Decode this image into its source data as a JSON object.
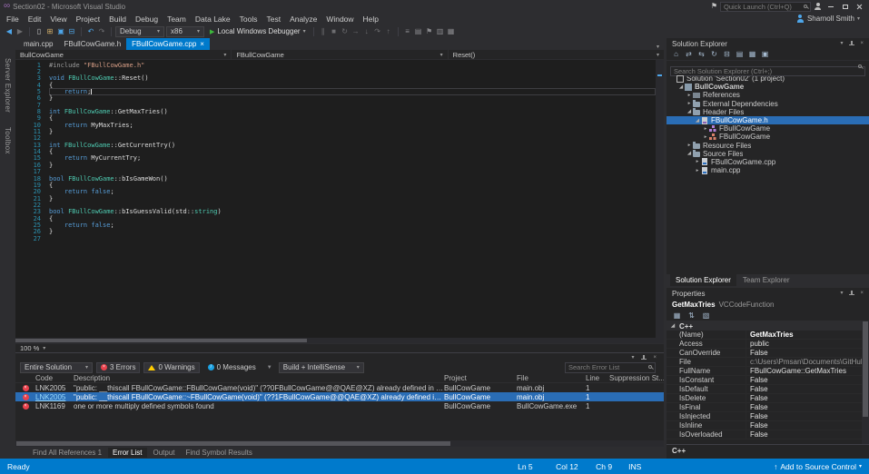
{
  "glyphs": {
    "caret": "▾",
    "chevron_down": "▾",
    "close": "×",
    "play": "▶",
    "flag": "⚑",
    "infinity": "∞",
    "up_arrow": "↑",
    "expand_down": "◢",
    "expand_right": "▸",
    "info_letter": "i",
    "filter": "▼"
  },
  "titlebar": {
    "title": "Section02 - Microsoft Visual Studio",
    "quick_launch_placeholder": "Quick Launch (Ctrl+Q)"
  },
  "menubar": {
    "items": [
      "File",
      "Edit",
      "View",
      "Project",
      "Build",
      "Debug",
      "Team",
      "Data Lake",
      "Tools",
      "Test",
      "Analyze",
      "Window",
      "Help"
    ],
    "account_name": "Sharnoll Smith"
  },
  "toolbar": {
    "icons_nav": [
      {
        "name": "navigate-back",
        "glyph": "◀",
        "color": "#4ea6ea"
      },
      {
        "name": "navigate-forward",
        "glyph": "▶",
        "color": "#6d6d70"
      }
    ],
    "icons_file": [
      {
        "name": "new-file",
        "glyph": "▯",
        "color": "#c8c8c8"
      },
      {
        "name": "open-file",
        "glyph": "⊞",
        "color": "#d8b36c"
      },
      {
        "name": "save",
        "glyph": "▣",
        "color": "#4ea6ea"
      },
      {
        "name": "save-all",
        "glyph": "⊟",
        "color": "#4ea6ea"
      }
    ],
    "icons_edit": [
      {
        "name": "undo",
        "glyph": "↶",
        "color": "#4ea6ea"
      },
      {
        "name": "redo",
        "glyph": "↷",
        "color": "#6d6d70"
      }
    ],
    "config": "Debug",
    "platform": "x86",
    "run_label": "Local Windows Debugger",
    "icons_debug": [
      {
        "name": "break-all",
        "glyph": "∥",
        "color": "#6d6d70"
      },
      {
        "name": "stop",
        "glyph": "■",
        "color": "#6d6d70"
      },
      {
        "name": "restart",
        "glyph": "↻",
        "color": "#6d6d70"
      },
      {
        "name": "show-next-statement",
        "glyph": "→",
        "color": "#6d6d70"
      },
      {
        "name": "step-into",
        "glyph": "↓",
        "color": "#6d6d70"
      },
      {
        "name": "step-over",
        "glyph": "↷",
        "color": "#6d6d70"
      },
      {
        "name": "step-out",
        "glyph": "↑",
        "color": "#6d6d70"
      }
    ],
    "icons_misc": [
      {
        "name": "solution-configurations",
        "glyph": "≡",
        "color": "#8a8a8e"
      },
      {
        "name": "find-in-files",
        "glyph": "▤",
        "color": "#8a8a8e"
      },
      {
        "name": "bookmark",
        "glyph": "⚑",
        "color": "#8a8a8e"
      },
      {
        "name": "comment",
        "glyph": "▥",
        "color": "#8a8a8e"
      },
      {
        "name": "uncomment",
        "glyph": "▦",
        "color": "#8a8a8e"
      }
    ]
  },
  "left_strip": {
    "tabs": [
      "Server Explorer",
      "Toolbox"
    ]
  },
  "editor": {
    "tabs": [
      {
        "label": "main.cpp",
        "active": false
      },
      {
        "label": "FBullCowGame.h",
        "active": false
      },
      {
        "label": "FBullCowGame.cpp",
        "active": true
      }
    ],
    "navbar": {
      "project": "BullCowGame",
      "type": "FBullCowGame",
      "member": "Reset()"
    },
    "zoom": "100 %",
    "lines": [
      {
        "n": 1,
        "s": [
          [
            "pp",
            "#include "
          ],
          [
            "str",
            "\"FBullCowGame.h\""
          ]
        ]
      },
      {
        "n": 2,
        "s": []
      },
      {
        "n": 3,
        "s": [
          [
            "kw",
            "void "
          ],
          [
            "ty",
            "FBullCowGame"
          ],
          [
            "pl",
            "::Reset()"
          ]
        ]
      },
      {
        "n": 4,
        "s": [
          [
            "pl",
            "{"
          ]
        ]
      },
      {
        "n": 5,
        "cur": true,
        "caret": true,
        "s": [
          [
            "pl",
            "    "
          ],
          [
            "kw",
            "return"
          ],
          [
            "pl",
            ";"
          ]
        ]
      },
      {
        "n": 6,
        "s": [
          [
            "pl",
            "}"
          ]
        ]
      },
      {
        "n": 7,
        "s": []
      },
      {
        "n": 8,
        "s": [
          [
            "kw",
            "int "
          ],
          [
            "ty",
            "FBullCowGame"
          ],
          [
            "pl",
            "::GetMaxTries()"
          ]
        ]
      },
      {
        "n": 9,
        "s": [
          [
            "pl",
            "{"
          ]
        ]
      },
      {
        "n": 10,
        "s": [
          [
            "pl",
            "    "
          ],
          [
            "kw",
            "return"
          ],
          [
            "pl",
            " MyMaxTries;"
          ]
        ]
      },
      {
        "n": 11,
        "s": [
          [
            "pl",
            "}"
          ]
        ]
      },
      {
        "n": 12,
        "s": []
      },
      {
        "n": 13,
        "s": [
          [
            "kw",
            "int "
          ],
          [
            "ty",
            "FBullCowGame"
          ],
          [
            "pl",
            "::GetCurrentTry()"
          ]
        ]
      },
      {
        "n": 14,
        "s": [
          [
            "pl",
            "{"
          ]
        ]
      },
      {
        "n": 15,
        "s": [
          [
            "pl",
            "    "
          ],
          [
            "kw",
            "return"
          ],
          [
            "pl",
            " MyCurrentTry;"
          ]
        ]
      },
      {
        "n": 16,
        "s": [
          [
            "pl",
            "}"
          ]
        ]
      },
      {
        "n": 17,
        "s": []
      },
      {
        "n": 18,
        "s": [
          [
            "kw",
            "bool "
          ],
          [
            "ty",
            "FBullCowGame"
          ],
          [
            "pl",
            "::bIsGameWon()"
          ]
        ]
      },
      {
        "n": 19,
        "s": [
          [
            "pl",
            "{"
          ]
        ]
      },
      {
        "n": 20,
        "s": [
          [
            "pl",
            "    "
          ],
          [
            "kw",
            "return"
          ],
          [
            "pl",
            " "
          ],
          [
            "kw",
            "false"
          ],
          [
            "pl",
            ";"
          ]
        ]
      },
      {
        "n": 21,
        "s": [
          [
            "pl",
            "}"
          ]
        ]
      },
      {
        "n": 22,
        "s": []
      },
      {
        "n": 23,
        "s": [
          [
            "kw",
            "bool "
          ],
          [
            "ty",
            "FBullCowGame"
          ],
          [
            "pl",
            "::bIsGuessValid(std::"
          ],
          [
            "ty",
            "string"
          ],
          [
            "pl",
            ")"
          ]
        ]
      },
      {
        "n": 24,
        "s": [
          [
            "pl",
            "{"
          ]
        ]
      },
      {
        "n": 25,
        "s": [
          [
            "pl",
            "    "
          ],
          [
            "kw",
            "return"
          ],
          [
            "pl",
            " "
          ],
          [
            "kw",
            "false"
          ],
          [
            "pl",
            ";"
          ]
        ]
      },
      {
        "n": 26,
        "s": [
          [
            "pl",
            "}"
          ]
        ]
      },
      {
        "n": 27,
        "s": []
      }
    ]
  },
  "error_list": {
    "scope_dropdown": "Entire Solution",
    "errors_label": "3 Errors",
    "warnings_label": "0 Warnings",
    "messages_label": "0 Messages",
    "source_dropdown": "Build + IntelliSense",
    "search_placeholder": "Search Error List",
    "columns": [
      "Code",
      "Description",
      "Project",
      "File",
      "Line",
      "Suppression St..."
    ],
    "rows": [
      {
        "severity": "error",
        "code": "LNK2005",
        "description": "\"public: __thiscall FBullCowGame::FBullCowGame(void)\" (??0FBullCowGame@@QAE@XZ) already defined in FBullCowGame.obj",
        "project": "BullCowGame",
        "file": "main.obj",
        "line": "1",
        "selected": false
      },
      {
        "severity": "error",
        "code": "LNK2005",
        "description": "\"public: __thiscall FBullCowGame::~FBullCowGame(void)\" (??1FBullCowGame@@QAE@XZ) already defined in FBullCowGame.obj",
        "project": "BullCowGame",
        "file": "main.obj",
        "line": "1",
        "selected": true
      },
      {
        "severity": "error",
        "code": "LNK1169",
        "description": "one or more multiply defined symbols found",
        "project": "BullCowGame",
        "file": "BullCowGame.exe",
        "line": "1",
        "selected": false
      }
    ]
  },
  "bottom_tabs": [
    {
      "label": "Find All References 1",
      "active": false
    },
    {
      "label": "Error List",
      "active": true
    },
    {
      "label": "Output",
      "active": false
    },
    {
      "label": "Find Symbol Results",
      "active": false
    }
  ],
  "solution_explorer": {
    "title": "Solution Explorer",
    "search_placeholder": "Search Solution Explorer (Ctrl+;)",
    "toolbar_icons": [
      {
        "name": "home",
        "glyph": "⌂"
      },
      {
        "name": "switch-views",
        "glyph": "⇄"
      },
      {
        "name": "sync-with-active-document",
        "glyph": "⇆"
      },
      {
        "name": "refresh",
        "glyph": "↻"
      },
      {
        "name": "collapse-all",
        "glyph": "⊟"
      },
      {
        "name": "show-all-files",
        "glyph": "▤"
      },
      {
        "name": "properties",
        "glyph": "▦"
      },
      {
        "name": "preview-selected-items",
        "glyph": "▣"
      }
    ],
    "tree": [
      {
        "indent": 0,
        "arrow": "",
        "icon": "solution",
        "label": "Solution 'Section02' (1 project)"
      },
      {
        "indent": 1,
        "arrow": "down",
        "icon": "cpp-project",
        "label": "BullCowGame",
        "bold": true
      },
      {
        "indent": 2,
        "arrow": "right",
        "icon": "references",
        "label": "References"
      },
      {
        "indent": 2,
        "arrow": "right",
        "icon": "external-dependencies",
        "label": "External Dependencies"
      },
      {
        "indent": 2,
        "arrow": "down",
        "icon": "folder",
        "label": "Header Files"
      },
      {
        "indent": 3,
        "arrow": "down",
        "icon": "header-file",
        "label": "FBullCowGame.h",
        "selected": true
      },
      {
        "indent": 4,
        "arrow": "right",
        "icon": "class",
        "label": "FBullCowGame"
      },
      {
        "indent": 4,
        "arrow": "right",
        "icon": "struct",
        "label": "FBullCowGame"
      },
      {
        "indent": 2,
        "arrow": "right",
        "icon": "folder",
        "label": "Resource Files"
      },
      {
        "indent": 2,
        "arrow": "down",
        "icon": "folder",
        "label": "Source Files"
      },
      {
        "indent": 3,
        "arrow": "right",
        "icon": "cpp-file",
        "label": "FBullCowGame.cpp"
      },
      {
        "indent": 3,
        "arrow": "right",
        "icon": "cpp-file",
        "label": "main.cpp"
      }
    ]
  },
  "panel_tabs": [
    {
      "label": "Solution Explorer",
      "active": true
    },
    {
      "label": "Team Explorer",
      "active": false
    }
  ],
  "properties": {
    "title": "Properties",
    "object_name": "GetMaxTries",
    "object_type": "VCCodeFunction",
    "toolbar_icons": [
      {
        "name": "categorized",
        "glyph": "▦"
      },
      {
        "name": "alphabetical",
        "glyph": "⇅"
      },
      {
        "name": "property-pages",
        "glyph": "▧"
      }
    ],
    "category": "C++",
    "rows": [
      [
        "(Name)",
        "GetMaxTries",
        "b"
      ],
      [
        "Access",
        "public",
        ""
      ],
      [
        "CanOverride",
        "False",
        ""
      ],
      [
        "File",
        "c:\\Users\\Pmsan\\Documents\\GitHub",
        "dim"
      ],
      [
        "FullName",
        "FBullCowGame::GetMaxTries",
        ""
      ],
      [
        "IsConstant",
        "False",
        ""
      ],
      [
        "IsDefault",
        "False",
        ""
      ],
      [
        "IsDelete",
        "False",
        ""
      ],
      [
        "IsFinal",
        "False",
        ""
      ],
      [
        "IsInjected",
        "False",
        ""
      ],
      [
        "IsInline",
        "False",
        ""
      ],
      [
        "IsOverloaded",
        "False",
        ""
      ]
    ],
    "footer": "C++"
  },
  "status_bar": {
    "ready": "Ready",
    "line": "Ln 5",
    "column": "Col 12",
    "character": "Ch 9",
    "mode": "INS",
    "source_control": "Add to Source Control"
  }
}
